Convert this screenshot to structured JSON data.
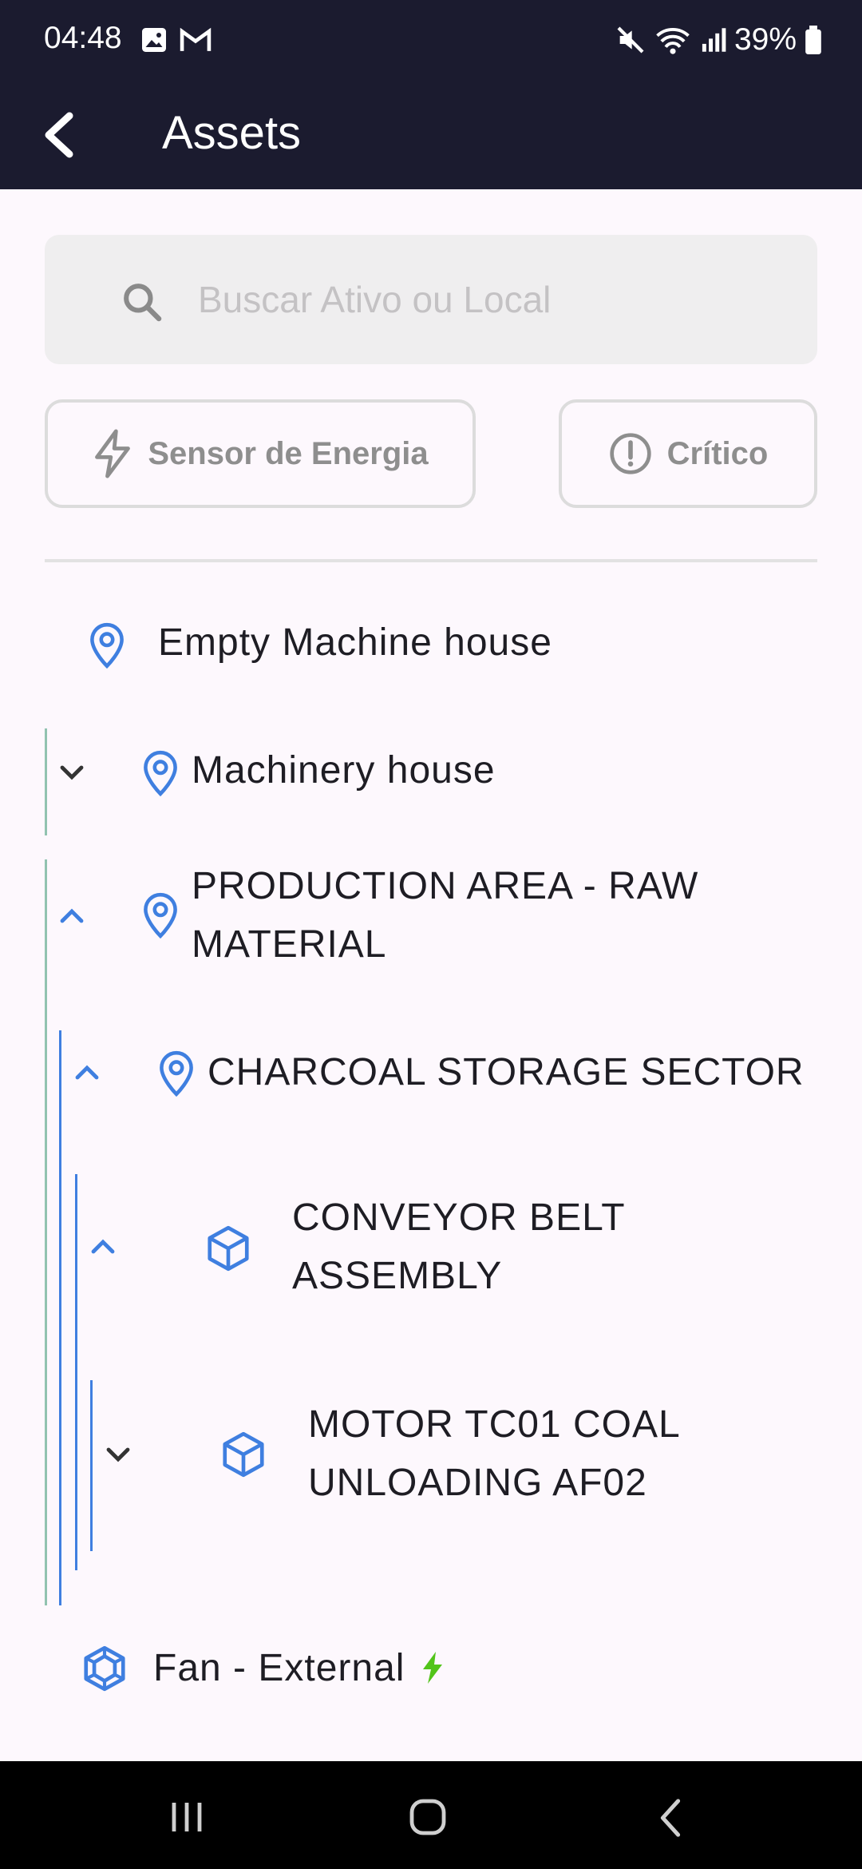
{
  "status_bar": {
    "time": "04:48",
    "battery": "39%",
    "icons_left": [
      "image-icon",
      "gmail-icon"
    ],
    "icons_right": [
      "mute-icon",
      "wifi-icon",
      "signal-icon",
      "battery-icon"
    ]
  },
  "app_bar": {
    "title": "Assets",
    "back_icon": "back-arrow-icon"
  },
  "search": {
    "placeholder": "Buscar Ativo ou Local"
  },
  "filters": {
    "energy_label": "Sensor de Energia",
    "critical_label": "Crítico"
  },
  "tree": {
    "items": [
      {
        "label": "Empty Machine house",
        "type": "location",
        "expanded": null
      },
      {
        "label": "Machinery house",
        "type": "location",
        "expanded": false
      },
      {
        "label_line1": "PRODUCTION AREA - RAW",
        "label_line2": "MATERIAL",
        "type": "location",
        "expanded": true
      },
      {
        "label": "CHARCOAL STORAGE SECTOR",
        "type": "location",
        "expanded": true
      },
      {
        "label_line1": "CONVEYOR BELT",
        "label_line2": "ASSEMBLY",
        "type": "asset",
        "expanded": true
      },
      {
        "label_line1": "MOTOR TC01 COAL",
        "label_line2": "UNLOADING AF02",
        "type": "asset",
        "expanded": false
      },
      {
        "label": "Fan - External",
        "type": "component",
        "sensor": "energy"
      }
    ]
  },
  "colors": {
    "header_bg": "#1b1b2f",
    "accent_blue": "#3f7fe0",
    "energy_green": "#52c41a",
    "background": "#fdf8fd"
  }
}
